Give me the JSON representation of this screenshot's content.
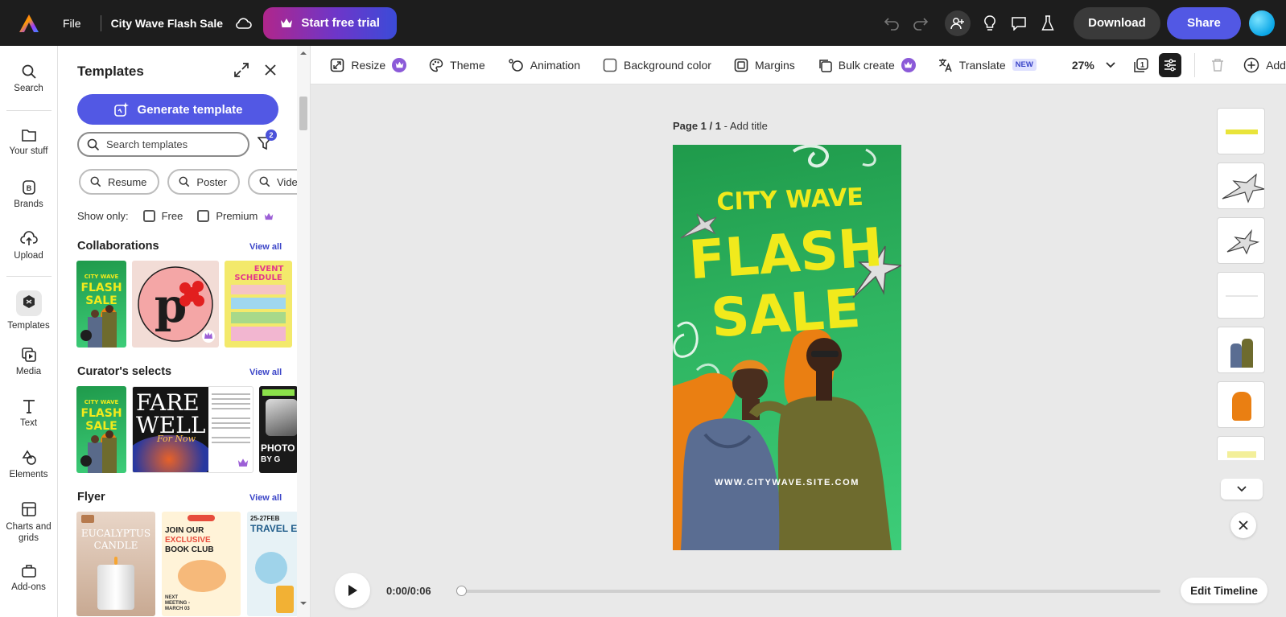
{
  "topbar": {
    "file_label": "File",
    "doc_title": "City Wave Flash Sale",
    "trial_label": "Start free trial",
    "download_label": "Download",
    "share_label": "Share"
  },
  "rail": {
    "items": [
      {
        "label": "Search",
        "icon": "search-icon"
      },
      {
        "label": "Your stuff",
        "icon": "folder-icon"
      },
      {
        "label": "Brands",
        "icon": "brand-icon"
      },
      {
        "label": "Upload",
        "icon": "upload-icon"
      },
      {
        "label": "Templates",
        "icon": "templates-icon"
      },
      {
        "label": "Media",
        "icon": "media-icon"
      },
      {
        "label": "Text",
        "icon": "text-icon"
      },
      {
        "label": "Elements",
        "icon": "elements-icon"
      },
      {
        "label": "Charts and grids",
        "icon": "charts-icon"
      },
      {
        "label": "Add-ons",
        "icon": "addons-icon"
      }
    ]
  },
  "panel": {
    "title": "Templates",
    "generate_label": "Generate template",
    "search_placeholder": "Search templates",
    "filter_count": "2",
    "chips": [
      "Resume",
      "Poster",
      "Video"
    ],
    "show_only_label": "Show only:",
    "free_label": "Free",
    "premium_label": "Premium",
    "sections": [
      {
        "title": "Collaborations",
        "view_all": "View all"
      },
      {
        "title": "Curator's selects",
        "view_all": "View all"
      },
      {
        "title": "Flyer",
        "view_all": "View all"
      }
    ],
    "thumb_text": {
      "event_title": "EVENT SCHEDULE",
      "farewell_1": "FARE",
      "farewell_2": "WELL",
      "farewell_3": "For Now",
      "photo_text": "PHOTO",
      "photo_sub": "BY G",
      "candle_1": "EUCALYPTUS",
      "candle_2": "CANDLE",
      "book_1": "JOIN OUR",
      "book_2": "EXCLUSIVE",
      "book_3": "BOOK CLUB",
      "book_date": "NEXT MEETING - MARCH 03",
      "travel_date": "25-27FEB",
      "travel_title": "TRAVEL E"
    }
  },
  "toolbar": {
    "resize": "Resize",
    "theme": "Theme",
    "animation": "Animation",
    "background_color": "Background color",
    "margins": "Margins",
    "bulk_create": "Bulk create",
    "translate": "Translate",
    "new_badge": "NEW",
    "zoom": "27%",
    "page_count": "1",
    "add": "Add"
  },
  "canvas": {
    "page_label": "Page 1 / 1",
    "add_title": " - Add title",
    "poster": {
      "line1": "CITY WAVE",
      "line2": "FLASH",
      "line3": "SALE",
      "url": "WWW.CITYWAVE.SITE.COM"
    }
  },
  "timeline": {
    "time": "0:00/0:06",
    "edit_label": "Edit Timeline",
    "progress": 0
  },
  "colors": {
    "accent": "#5258e4",
    "poster_green": "#2fb561",
    "poster_yellow": "#f1ea1c",
    "poster_orange": "#ea7f12"
  }
}
